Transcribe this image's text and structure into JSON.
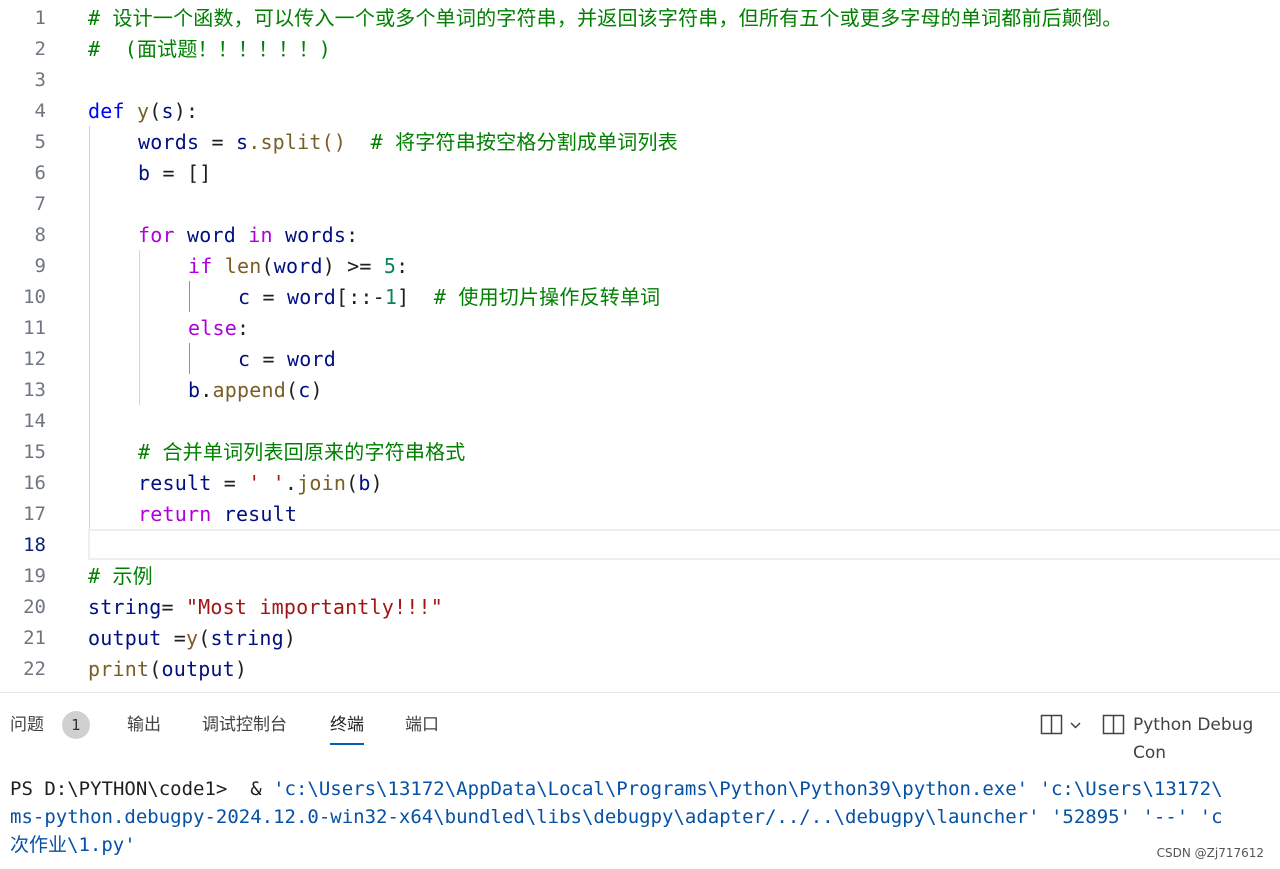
{
  "editor": {
    "lines": [
      {
        "n": "1",
        "text": "# 设计一个函数，可以传入一个或多个单词的字符串，并返回该字符串，但所有五个或更多字母的单词都前后颠倒。"
      },
      {
        "n": "2",
        "text": "#  (面试题！！！！！！)"
      },
      {
        "n": "3",
        "text": ""
      },
      {
        "n": "4",
        "t": [
          "def",
          " ",
          "y",
          "(",
          "s",
          "):"
        ]
      },
      {
        "n": "5",
        "t": [
          "words",
          " = ",
          "s",
          ".split()",
          "  # 将字符串按空格分割成单词列表"
        ]
      },
      {
        "n": "6",
        "t": [
          "b",
          " = []"
        ]
      },
      {
        "n": "7",
        "text": ""
      },
      {
        "n": "8",
        "t": [
          "for",
          " ",
          "word",
          " ",
          "in",
          " ",
          "words",
          ":"
        ]
      },
      {
        "n": "9",
        "t": [
          "if",
          " ",
          "len",
          "(",
          "word",
          ") >= ",
          "5",
          ":"
        ]
      },
      {
        "n": "10",
        "t": [
          "c",
          " = ",
          "word",
          "[::-",
          "1",
          "]",
          "  # 使用切片操作反转单词"
        ]
      },
      {
        "n": "11",
        "t": [
          "else",
          ":"
        ]
      },
      {
        "n": "12",
        "t": [
          "c",
          " = ",
          "word"
        ]
      },
      {
        "n": "13",
        "t": [
          "b",
          ".",
          "append",
          "(",
          "c",
          ")"
        ]
      },
      {
        "n": "14",
        "text": ""
      },
      {
        "n": "15",
        "t": [
          "# 合并单词列表回原来的字符串格式"
        ]
      },
      {
        "n": "16",
        "t": [
          "result",
          " = ",
          "' '",
          ".",
          "join",
          "(",
          "b",
          ")"
        ]
      },
      {
        "n": "17",
        "t": [
          "return",
          " ",
          "result"
        ]
      },
      {
        "n": "18",
        "text": ""
      },
      {
        "n": "19",
        "t": [
          "# 示例"
        ]
      },
      {
        "n": "20",
        "t": [
          "string",
          "= ",
          "\"Most importantly!!!\""
        ]
      },
      {
        "n": "21",
        "t": [
          "output",
          " =",
          "y",
          "(",
          "string",
          ")"
        ]
      },
      {
        "n": "22",
        "t": [
          "print",
          "(",
          "output",
          ")"
        ]
      }
    ]
  },
  "panel": {
    "tabs": [
      {
        "label": "问题"
      },
      {
        "label": "输出"
      },
      {
        "label": "调试控制台"
      },
      {
        "label": "终端"
      },
      {
        "label": "端口"
      }
    ],
    "problems_count": "1",
    "terminal_name": "Python Debug Con",
    "terminal": {
      "l1_prompt": "PS D:\\PYTHON\\code1>  & ",
      "l1_str": "'c:\\Users\\13172\\AppData\\Local\\Programs\\Python\\Python39\\python.exe' 'c:\\Users\\13172\\",
      "l2": "ms-python.debugpy-2024.12.0-win32-x64\\bundled\\libs\\debugpy\\adapter/../..\\debugpy\\launcher' '52895' '--' 'c",
      "l3": "次作业\\1.py'"
    }
  },
  "watermark": "CSDN @Zj717612"
}
